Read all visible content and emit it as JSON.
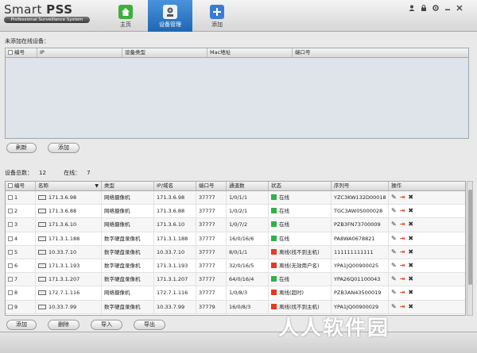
{
  "app": {
    "name_light": "Smart ",
    "name_bold": "PSS",
    "subtitle": "Professional Surveillance System"
  },
  "nav": [
    {
      "label": "主页",
      "icon": "home-icon",
      "color": "#3fae3f"
    },
    {
      "label": "设备管理",
      "icon": "device-manager-icon",
      "color": "#ffffff"
    },
    {
      "label": "添加",
      "icon": "plus-icon",
      "color": "#3b7bd4"
    }
  ],
  "window_controls": [
    "user-icon",
    "lock-icon",
    "settings-icon",
    "minimize-icon",
    "close-icon"
  ],
  "online": {
    "label": "未添加在线设备：",
    "columns": [
      "编号",
      "IP",
      "设备类型",
      "Mac地址",
      "端口号"
    ],
    "refresh": "刷新",
    "add": "添加"
  },
  "summary": {
    "total_label": "设备总数：",
    "total": "12",
    "online_label": "在线：",
    "online": "7"
  },
  "devices": {
    "columns": [
      "编号",
      "名称",
      "类型",
      "IP/域名",
      "端口号",
      "通道数",
      "状态",
      "序列号",
      "操作"
    ],
    "rows": [
      {
        "no": "1",
        "name": "171.3.6.98",
        "type": "网络摄像机",
        "ip": "171.3.6.98",
        "port": "37777",
        "ch": "1/0/1/1",
        "status": "在线",
        "color": "#2fb14a",
        "sn": "YZC3KW132D00018"
      },
      {
        "no": "2",
        "name": "171.3.6.88",
        "type": "网络摄像机",
        "ip": "171.3.6.88",
        "port": "37777",
        "ch": "1/0/2/1",
        "status": "在线",
        "color": "#2fb14a",
        "sn": "TGC3AW0S000028"
      },
      {
        "no": "3",
        "name": "171.3.6.10",
        "type": "网络摄像机",
        "ip": "171.3.6.10",
        "port": "37777",
        "ch": "1/0/7/2",
        "status": "在线",
        "color": "#2fb14a",
        "sn": "PZB3FN73700009"
      },
      {
        "no": "4",
        "name": "171.3.1.188",
        "type": "数字硬盘录像机",
        "ip": "171.3.1.188",
        "port": "37777",
        "ch": "16/0/16/6",
        "status": "在线",
        "color": "#2fb14a",
        "sn": "PA8WA0678821"
      },
      {
        "no": "5",
        "name": "10.33.7.10",
        "type": "数字硬盘录像机",
        "ip": "10.33.7.10",
        "port": "37777",
        "ch": "8/0/1/1",
        "status": "离线(找不到主机)",
        "color": "#e63a1e",
        "sn": "111111111111"
      },
      {
        "no": "6",
        "name": "171.3.1.193",
        "type": "数字硬盘录像机",
        "ip": "171.3.1.193",
        "port": "37777",
        "ch": "32/0/16/5",
        "status": "离线(无效用户名)",
        "color": "#e63a1e",
        "sn": "YPA1JQ00900025"
      },
      {
        "no": "7",
        "name": "171.3.1.207",
        "type": "数字硬盘录像机",
        "ip": "171.3.1.207",
        "port": "37777",
        "ch": "64/0/16/4",
        "status": "在线",
        "color": "#2fb14a",
        "sn": "YPA26Q01100043"
      },
      {
        "no": "8",
        "name": "172.7.1.116",
        "type": "网络摄像机",
        "ip": "172.7.1.116",
        "port": "37777",
        "ch": "1/0/8/3",
        "status": "离线(超时)",
        "color": "#e63a1e",
        "sn": "PZB3AN43500019"
      },
      {
        "no": "9",
        "name": "10.33.7.99",
        "type": "数字硬盘录像机",
        "ip": "10.33.7.99",
        "port": "37779",
        "ch": "16/0/8/3",
        "status": "离线(找不到主机)",
        "color": "#e63a1e",
        "sn": "YPA1JQ00900029"
      }
    ]
  },
  "bottom_buttons": [
    "添加",
    "删除",
    "导入",
    "导出"
  ],
  "watermark": "人人软件园"
}
